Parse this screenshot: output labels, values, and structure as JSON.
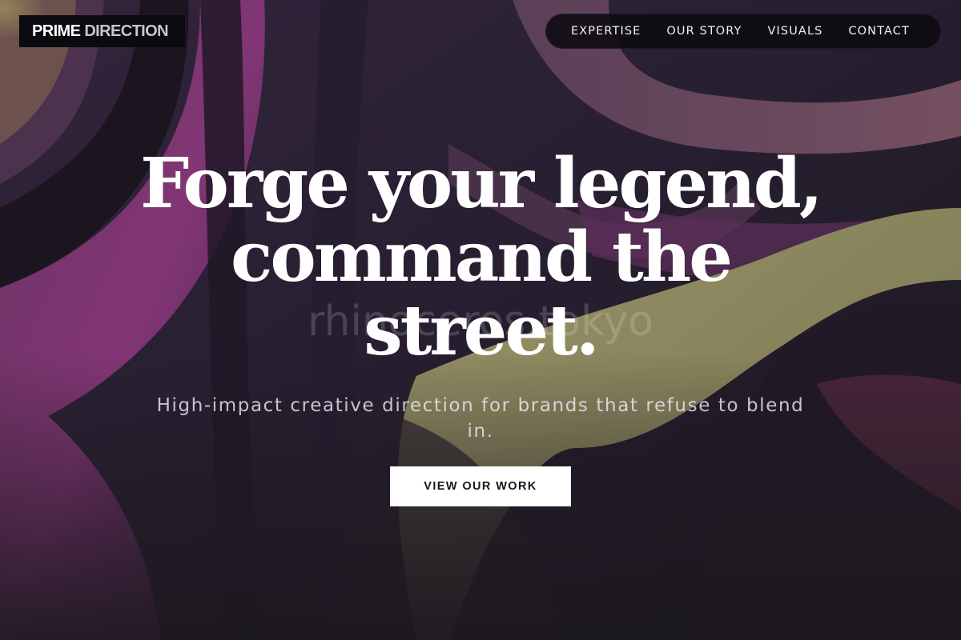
{
  "brand": {
    "name_part1": "PRIME",
    "name_part2": "DIRECTION"
  },
  "nav": {
    "items": [
      {
        "label": "EXPERTISE"
      },
      {
        "label": "OUR STORY"
      },
      {
        "label": "VISUALS"
      },
      {
        "label": "CONTACT"
      }
    ]
  },
  "hero": {
    "headline": "Forge your legend, command the street.",
    "subheadline": "High-impact creative direction for brands that refuse to blend in.",
    "cta_label": "VIEW OUR WORK",
    "watermark": "rhinoceros.tokyo"
  },
  "colors": {
    "background_dark": "#1f1b2a",
    "purple": "#8a3a7e",
    "olive": "#a9a36a",
    "cta_bg": "#ffffff",
    "cta_text": "#17141c"
  }
}
